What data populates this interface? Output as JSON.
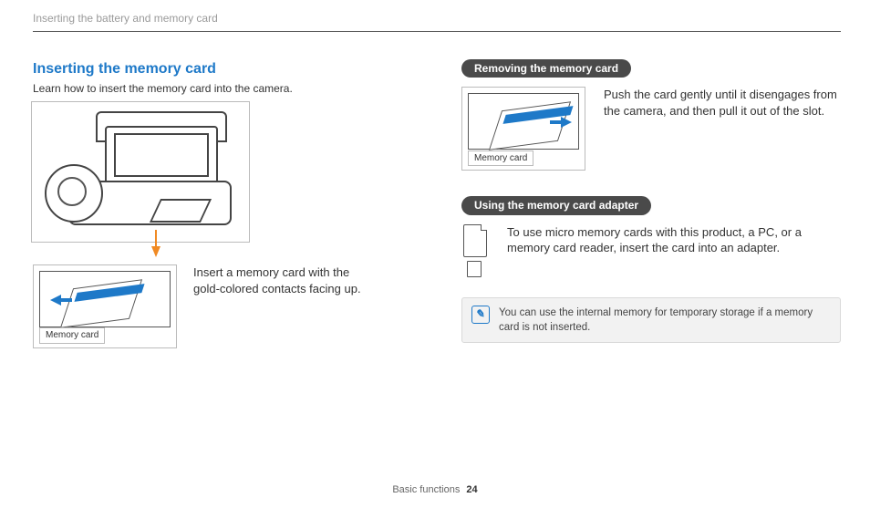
{
  "breadcrumb": "Inserting the battery and memory card",
  "left": {
    "title": "Inserting the memory card",
    "lede": "Learn how to insert the memory card into the camera.",
    "memory_card_label": "Memory card",
    "insert_text": "Insert a memory card with the gold-colored contacts facing up."
  },
  "right": {
    "removing_pill": "Removing the memory card",
    "removing_text": "Push the card gently until it disengages from the camera, and then pull it out of the slot.",
    "memory_card_label": "Memory card",
    "adapter_pill": "Using the memory card adapter",
    "adapter_text": "To use micro memory cards with this product, a PC, or a memory card reader, insert the card into an adapter.",
    "note_text": "You can use the internal memory for temporary storage if a memory card is not inserted."
  },
  "footer": {
    "section": "Basic functions",
    "page": "24"
  }
}
